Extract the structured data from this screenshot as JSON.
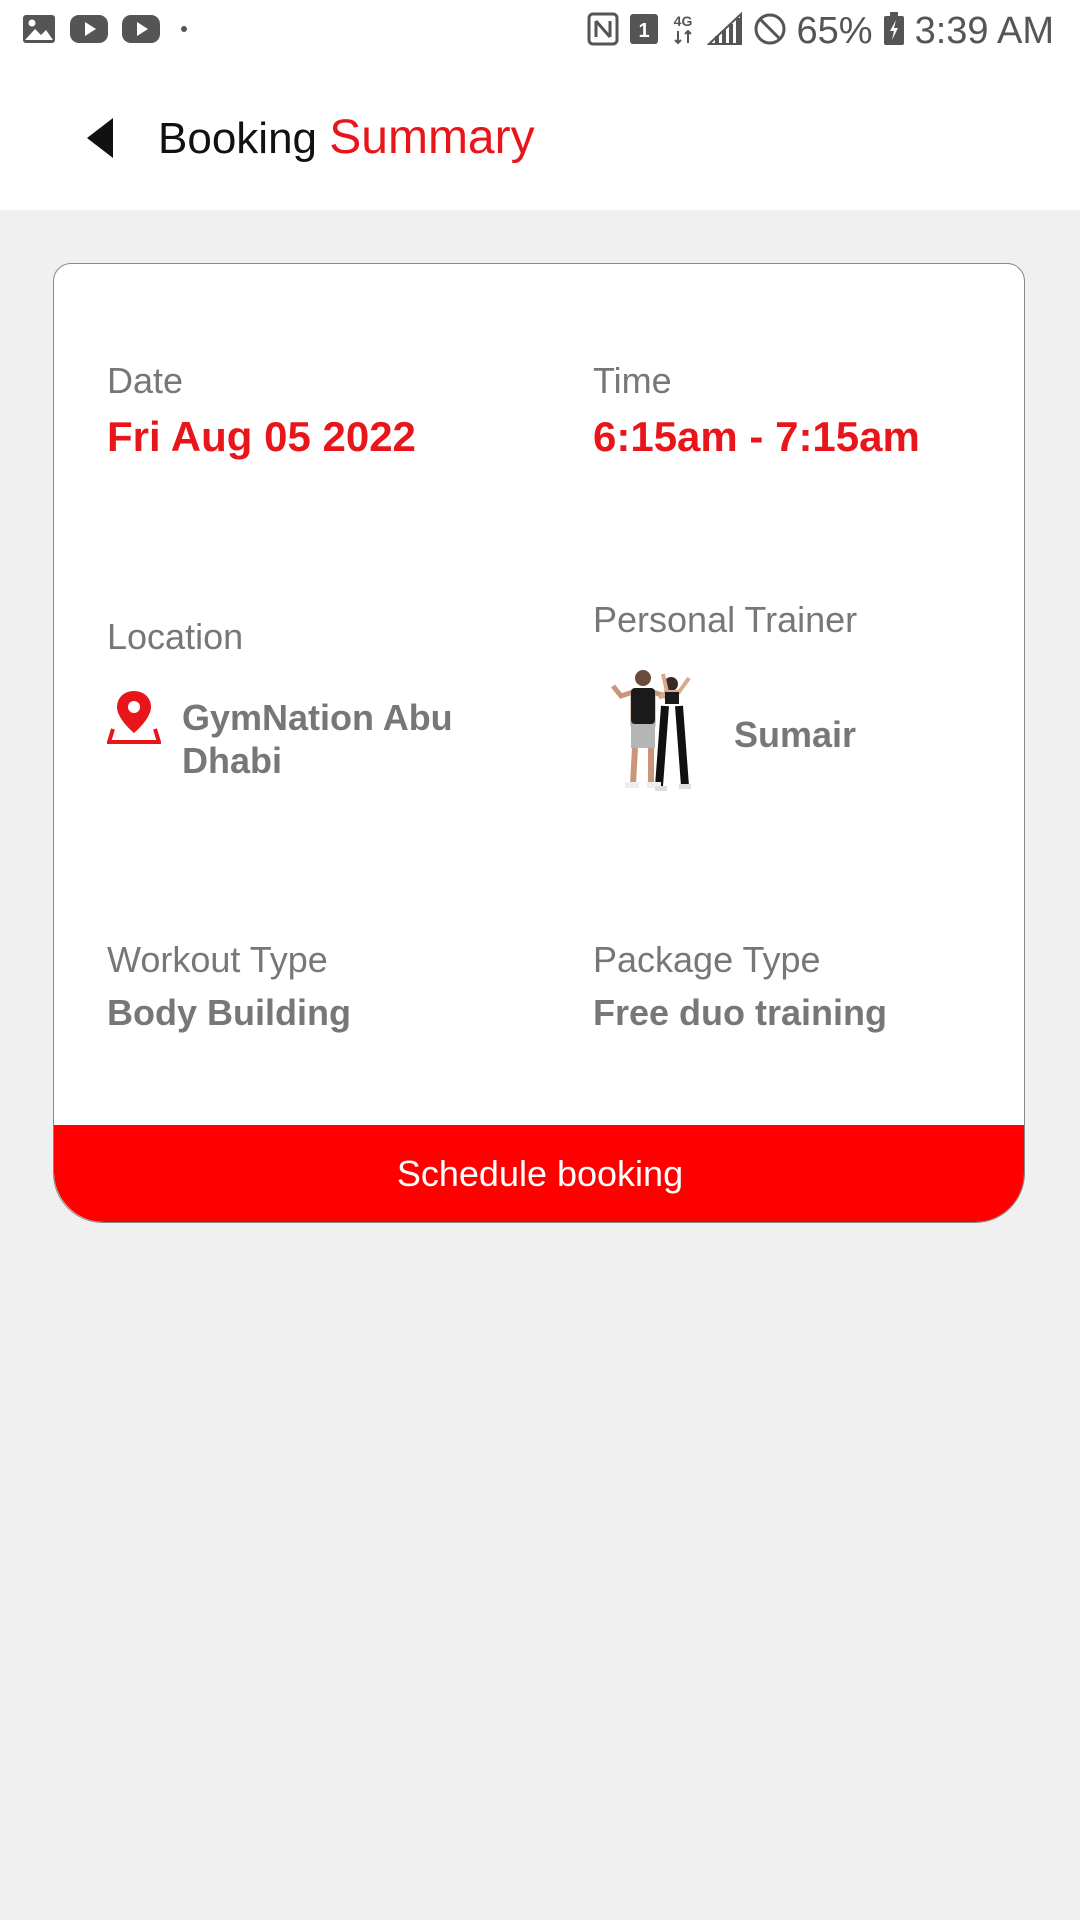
{
  "status_bar": {
    "battery": "65%",
    "time": "3:39 AM",
    "network": "4G",
    "sim": "1"
  },
  "header": {
    "title_part1": "Booking",
    "title_part2": "Summary"
  },
  "booking": {
    "date_label": "Date",
    "date_value": "Fri Aug 05 2022",
    "time_label": "Time",
    "time_value": "6:15am - 7:15am",
    "location_label": "Location",
    "location_value": "GymNation Abu Dhabi",
    "trainer_label": "Personal Trainer",
    "trainer_name": "Sumair",
    "workout_label": "Workout Type",
    "workout_value": "Body Building",
    "package_label": "Package Type",
    "package_value": "Free duo training"
  },
  "actions": {
    "schedule_label": "Schedule booking"
  },
  "colors": {
    "accent": "#e8161b",
    "button": "#ff0000"
  }
}
